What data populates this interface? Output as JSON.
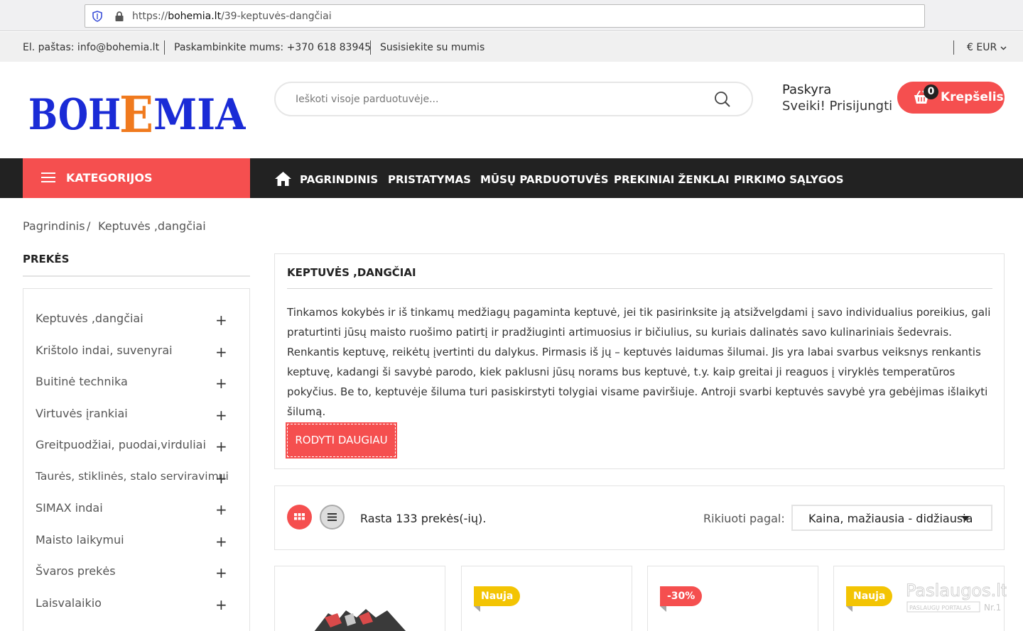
{
  "browser": {
    "url_prefix": "https://",
    "url_host": "bohemia.lt",
    "url_path": "/39-keptuvės-dangčiai"
  },
  "topbar": {
    "email": "El. paštas: info@bohemia.lt",
    "phone": "Paskambinkite mums: +370 618 83945",
    "contact": "Susisiekite su mumis",
    "currency": "€ EUR"
  },
  "header": {
    "logo_text": "BOHEMIA",
    "search_placeholder": "Ieškoti visoje parduotuvėje...",
    "account_title": "Paskyra",
    "account_link": "Sveiki! Prisijungti",
    "cart_label": "Krepšelis",
    "cart_count": "0"
  },
  "nav": {
    "categories_label": "KATEGORIJOS",
    "items": [
      "PAGRINDINIS",
      "PRISTATYMAS",
      "MŪSŲ PARDUOTUVĖS",
      "PREKINIAI ŽENKLAI",
      "PIRKIMO SĄLYGOS"
    ]
  },
  "breadcrumb": {
    "home": "Pagrindinis",
    "sep": "/",
    "current": "Keptuvės ,dangčiai"
  },
  "sidebar": {
    "title": "PREKĖS",
    "items": [
      "Keptuvės ,dangčiai",
      "Krištolo indai, suvenyrai",
      "Buitinė technika",
      "Virtuvės įrankiai",
      "Greitpuodžiai, puodai,virduliai",
      "Taurės, stiklinės, stalo serviravimui",
      "SIMAX indai",
      "Maisto laikymui",
      "Švaros prekės",
      "Laisvalaikio"
    ],
    "expand_symbol": "+"
  },
  "category": {
    "title": "KEPTUVĖS ,DANGČIAI",
    "description": "Tinkamos kokybės ir iš tinkamų medžiagų pagaminta keptuvė, jei tik pasirinksite ją atsižvelgdami į savo individualius poreikius, gali praturtinti jūsų maisto ruošimo patirtį ir pradžiuginti artimuosius ir bičiulius, su kuriais dalinatės savo kulinariniais šedevrais. Renkantis keptuvę, reikėtų įvertinti du dalykus.  Pirmasis iš jų – keptuvės laidumas šilumai.  Jis yra labai svarbus veiksnys renkantis keptuvę, kadangi ši savybė parodo, kiek paklusni jūsų norams bus keptuvė, t.y. kaip greitai ji reaguos į viryklės temperatūros pokyčius.  Be to, keptuvėje šiluma turi pasiskirstyti tolygiai visame paviršiuje. Antroji svarbi keptuvės savybė yra gebėjimas išlaikyti šilumą.",
    "more_button": "RODYTI DAUGIAU"
  },
  "listing": {
    "found_text": "Rasta 133 prekės(-ių).",
    "sort_label": "Rikiuoti pagal:",
    "sort_value": "Kaina, mažiausia - didžiausia"
  },
  "products": [
    {
      "badge": ""
    },
    {
      "badge": "Nauja"
    },
    {
      "badge": "-30%"
    },
    {
      "badge": "Nauja"
    }
  ],
  "watermark": {
    "line1": "Paslaugos.lt",
    "line2": "PASLAUGŲ PORTALAS",
    "line3": "Nr.1"
  },
  "colors": {
    "accent": "#f54f4f",
    "nav_bg": "#222222",
    "badge_new": "#f3c403",
    "logo_blue": "#1a2bd6",
    "logo_orange": "#f07a1e"
  }
}
